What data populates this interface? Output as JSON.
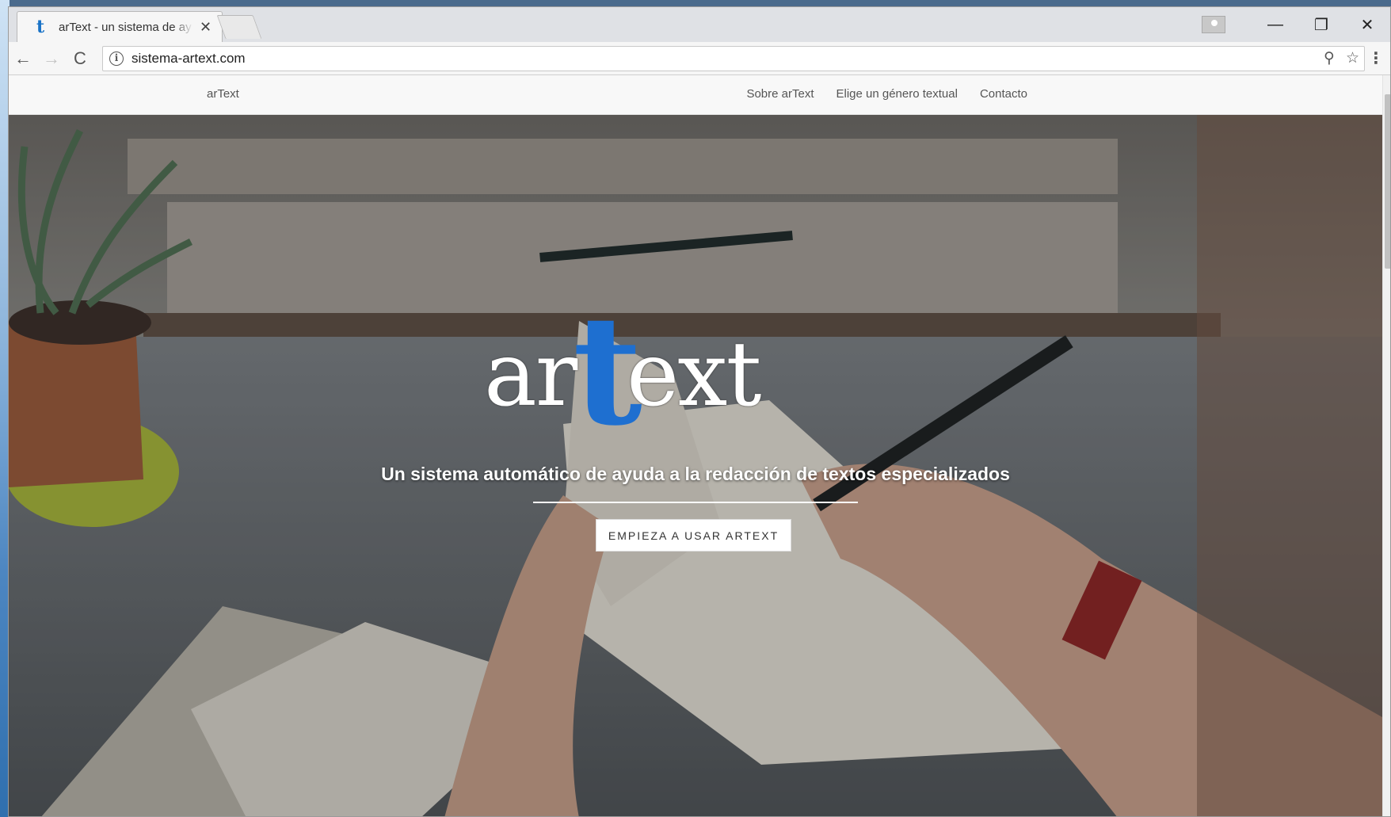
{
  "browser": {
    "tab_title": "arText - un sistema de ay",
    "tab_favicon": "t",
    "tab_close": "✕",
    "url": "sistema-artext.com",
    "nav": {
      "back": "←",
      "forward": "→",
      "reload": "C"
    },
    "omnibox_icons": {
      "zoom": "⚲",
      "star": "☆"
    },
    "menu": "⋮",
    "window_controls": {
      "minimize": "—",
      "restore": "❐",
      "close": "✕"
    }
  },
  "site": {
    "brand": "arText",
    "nav_links": [
      "Sobre arText",
      "Elige un género textual",
      "Contacto"
    ]
  },
  "hero": {
    "logo_text_left": "ar",
    "logo_t": "t",
    "logo_text_right": "ext",
    "tagline": "Un sistema automático de ayuda a la redacción de textos especializados",
    "cta_label": "EMPIEZA A USAR ARTEXT"
  },
  "colors": {
    "logo_t": "#1e6fd0",
    "hero_tint": "#5a5d60"
  }
}
